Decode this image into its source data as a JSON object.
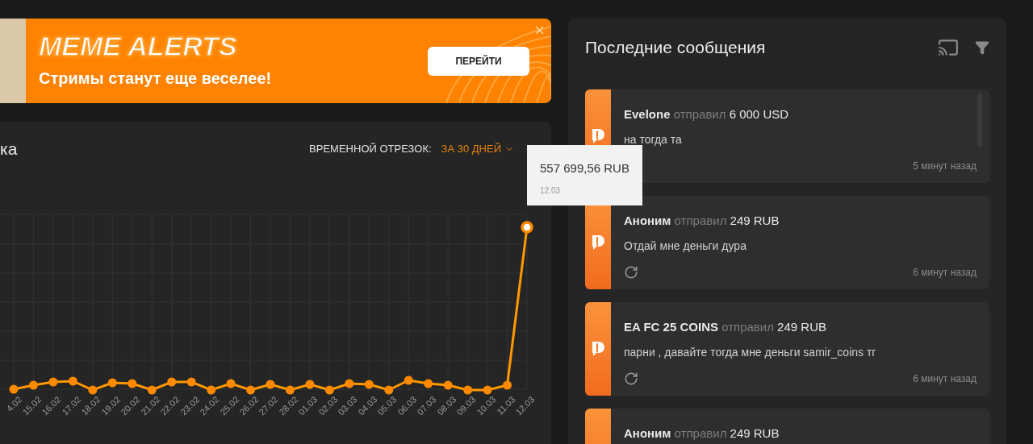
{
  "banner": {
    "logo": "MEME ALERTS",
    "tagline": "Стримы станут еще веселее!",
    "button": "ПЕРЕЙТИ",
    "close": "×"
  },
  "chart_card": {
    "title": "ка",
    "period_label": "ВРЕМЕННОЙ ОТРЕЗОК:",
    "period_value": "ЗА 30 ДНЕЙ",
    "axis_labels": [
      "4.02",
      "15.02",
      "16.02",
      "17.02",
      "18.02",
      "19.02",
      "20.02",
      "21.02",
      "22.02",
      "23.02",
      "24.02",
      "25.02",
      "26.02",
      "27.02",
      "28.02",
      "01.03",
      "02.03",
      "03.03",
      "04.03",
      "05.03",
      "06.03",
      "07.03",
      "08.03",
      "09.03",
      "10.03",
      "11.03",
      "12.03"
    ],
    "tooltip": {
      "value": "557 699,56 RUB",
      "date": "12.03"
    }
  },
  "messages_panel": {
    "title": "Последние сообщения",
    "messages": [
      {
        "sender": "Evelone",
        "verb": "отправил",
        "amount": "6 000 USD",
        "text": "на тогда та",
        "time": "5 минут назад"
      },
      {
        "sender": "Аноним",
        "verb": "отправил",
        "amount": "249 RUB",
        "text": "Отдай мне деньги дура",
        "time": "6 минут назад",
        "resendable": true
      },
      {
        "sender": "EA FC 25 COINS",
        "verb": "отправил",
        "amount": "249 RUB",
        "text": "парни , давайте тогда мне деньги samir_coins тг",
        "time": "6 минут назад",
        "resendable": true
      },
      {
        "sender": "Аноним",
        "verb": "отправил",
        "amount": "249 RUB"
      }
    ]
  }
}
